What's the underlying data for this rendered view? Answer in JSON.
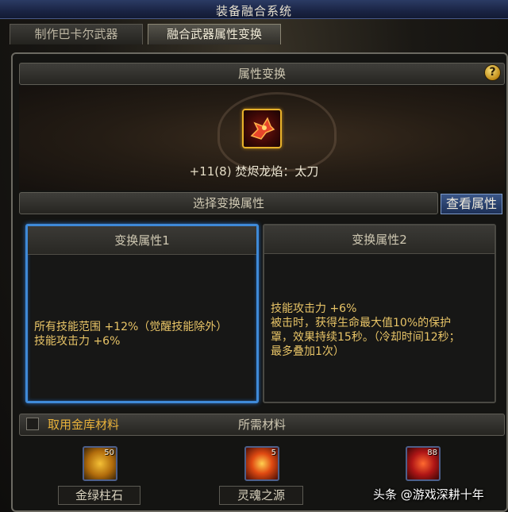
{
  "window": {
    "title": "装备融合系统"
  },
  "tabs": [
    {
      "label": "制作巴卡尔武器",
      "active": false
    },
    {
      "label": "融合武器属性变换",
      "active": true
    }
  ],
  "section1": {
    "title": "属性变换",
    "help_icon": "question-mark-icon"
  },
  "weapon": {
    "enhance": "+11(8)",
    "name": "焚烬龙焰：太刀"
  },
  "section2": {
    "title": "选择变换属性",
    "view_button": "查看属性"
  },
  "attributes": [
    {
      "title": "变换属性1",
      "selected": true,
      "lines": [
        "所有技能范围 +12%（觉醒技能除外）",
        "技能攻击力 +6%"
      ]
    },
    {
      "title": "变换属性2",
      "selected": false,
      "lines": [
        "技能攻击力 +6%",
        "被击时，获得生命最大值10%的保护",
        "罩，效果持续15秒。（冷却时间12秒；",
        "最多叠加1次）"
      ]
    }
  ],
  "materials_section": {
    "checkbox_label": "取用金库材料",
    "title": "所需材料"
  },
  "materials": [
    {
      "count": "50",
      "label": "金绿柱石",
      "icon": "gem-icon"
    },
    {
      "count": "5",
      "label": "灵魂之源",
      "icon": "soul-orb-icon"
    },
    {
      "count": "88",
      "label": "",
      "icon": "flame-crystal-icon"
    }
  ],
  "watermark": "头条 @游戏深耕十年",
  "colors": {
    "accent_blue": "#3f8ad8",
    "text_gold": "#e8c467",
    "label_orange": "#e8b13a"
  }
}
